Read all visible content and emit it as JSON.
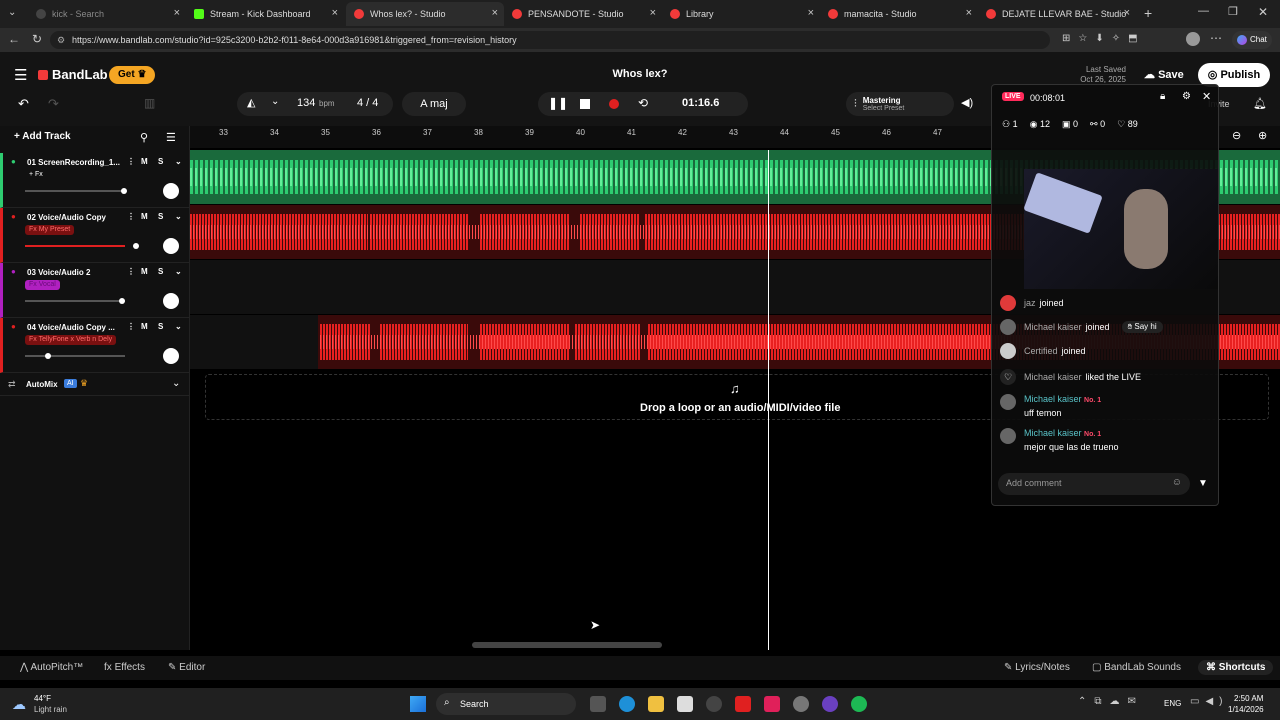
{
  "browser": {
    "tabs": [
      {
        "label": "kick - Search",
        "active": false
      },
      {
        "label": "Stream - Kick Dashboard",
        "active": false
      },
      {
        "label": "Whos lex? - Studio",
        "active": true
      },
      {
        "label": "PENSANDOTE - Studio",
        "active": false
      },
      {
        "label": "Library",
        "active": false
      },
      {
        "label": "mamacita - Studio",
        "active": false
      },
      {
        "label": "DEJATE LLEVAR BAE - Studio",
        "active": false
      }
    ],
    "url": "https://www.bandlab.com/studio?id=925c3200-b2b2-f011-8e64-000d3a916981&triggered_from=revision_history",
    "chat_label": "Chat"
  },
  "app": {
    "logo": "BandLab",
    "get_label": "Get",
    "project_title": "Whos lex?",
    "last_saved_label": "Last Saved",
    "last_saved_date": "Oct 26, 2025",
    "save_label": "Save",
    "publish_label": "Publish",
    "invite_label": "Invite",
    "tempo": "134",
    "tempo_unit": "bpm",
    "time_sig": "4 / 4",
    "key": "A maj",
    "time": "01:16.6",
    "mastering_label": "Mastering",
    "mastering_preset": "Select Preset"
  },
  "toolbar": {
    "add_track_label": "Add Track"
  },
  "ruler": [
    "33",
    "34",
    "35",
    "36",
    "37",
    "38",
    "39",
    "40",
    "41",
    "42",
    "43",
    "44",
    "45",
    "46",
    "47"
  ],
  "tracks": [
    {
      "name": "01  ScreenRecording_1...",
      "fx": "+ Fx",
      "color": "#2ecc71"
    },
    {
      "name": "02  Voice/Audio Copy",
      "fx": "Fx  My Preset",
      "color": "#e02020"
    },
    {
      "name": "03  Voice/Audio 2",
      "fx": "Fx  Vocal",
      "color": "#b020c0"
    },
    {
      "name": "04  Voice/Audio Copy ...",
      "fx": "Fx  TellyFone x Verb n Dely",
      "color": "#e02020"
    }
  ],
  "automix": {
    "label": "AutoMix",
    "badge": "AI"
  },
  "drop_text": "Drop a loop or an audio/MIDI/video file",
  "live": {
    "badge": "LIVE",
    "duration": "00:08:01",
    "stats": {
      "users": "1",
      "views": "12",
      "gifts": "0",
      "shares": "0",
      "likes": "89"
    },
    "chat": [
      {
        "user": "jaz",
        "text": "joined"
      },
      {
        "user": "Michael kaiser",
        "text": "joined",
        "extra": "Say hi"
      },
      {
        "user": "Certified",
        "text": "joined"
      },
      {
        "user": "Michael kaiser",
        "text": "liked the LIVE"
      },
      {
        "user": "Michael kaiser",
        "badge": "No. 1",
        "text": "uff temon"
      },
      {
        "user": "Michael kaiser",
        "badge": "No. 1",
        "text": "mejor que las de trueno"
      }
    ],
    "comment_placeholder": "Add comment"
  },
  "bottom": {
    "autopitch": "AutoPitch™",
    "effects": "Effects",
    "editor": "Editor",
    "lyrics": "Lyrics/Notes",
    "sounds": "BandLab Sounds",
    "shortcuts": "Shortcuts"
  },
  "taskbar": {
    "weather_temp": "44°F",
    "weather_desc": "Light rain",
    "search": "Search",
    "lang": "ENG",
    "time": "2:50 AM",
    "date": "1/14/2026"
  }
}
